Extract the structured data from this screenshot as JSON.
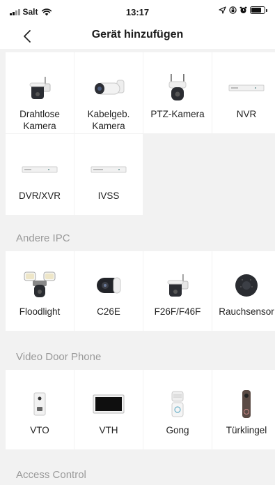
{
  "status_bar": {
    "carrier": "Salt",
    "time": "13:17"
  },
  "nav": {
    "title": "Gerät hinzufügen"
  },
  "main_devices": [
    {
      "label": "Drahtlose\nKamera",
      "icon": "wireless-camera-icon"
    },
    {
      "label": "Kabelgeb.\nKamera",
      "icon": "wired-camera-icon"
    },
    {
      "label": "PTZ-Kamera",
      "icon": "ptz-camera-icon"
    },
    {
      "label": "NVR",
      "icon": "nvr-icon"
    },
    {
      "label": "DVR/XVR",
      "icon": "dvr-icon"
    },
    {
      "label": "IVSS",
      "icon": "ivss-icon"
    }
  ],
  "sections": [
    {
      "title": "Andere IPC",
      "items": [
        {
          "label": "Floodlight",
          "icon": "floodlight-camera-icon"
        },
        {
          "label": "C26E",
          "icon": "c26e-camera-icon"
        },
        {
          "label": "F26F/F46F",
          "icon": "f26f-camera-icon"
        },
        {
          "label": "Rauchsensor",
          "icon": "smoke-sensor-icon"
        }
      ]
    },
    {
      "title": "Video Door Phone",
      "items": [
        {
          "label": "VTO",
          "icon": "vto-icon"
        },
        {
          "label": "VTH",
          "icon": "vth-monitor-icon"
        },
        {
          "label": "Gong",
          "icon": "chime-icon"
        },
        {
          "label": "Türklingel",
          "icon": "doorbell-icon"
        }
      ]
    },
    {
      "title": "Access Control",
      "items": []
    }
  ]
}
